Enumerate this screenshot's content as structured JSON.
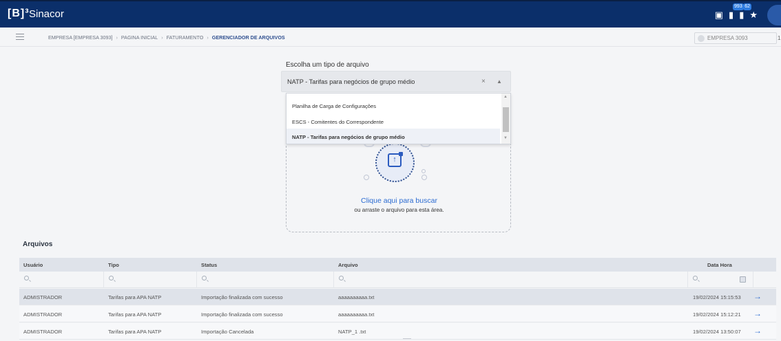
{
  "topbar": {
    "logo": "[B]³",
    "app_name": "Sinacor",
    "icons": [
      {
        "name": "document-icon",
        "glyph": "▣",
        "badge": ""
      },
      {
        "name": "notifications-icon",
        "glyph": "▮",
        "badge": "993"
      },
      {
        "name": "messages-icon",
        "glyph": "▮",
        "badge": "62"
      },
      {
        "name": "favorites-icon",
        "glyph": "★",
        "badge": ""
      }
    ],
    "colors": {
      "bar": "#0b2f6a",
      "badge": "#2f7de1"
    }
  },
  "breadcrumb": {
    "items": [
      "EMPRESA [EMPRESA 3093]",
      "PAGINA INICIAL",
      "FATURAMENTO"
    ],
    "current": "GERENCIADOR DE ARQUIVOS",
    "separator": "›"
  },
  "company_selector": {
    "placeholder": "EMPRESA 3093",
    "edge_text": "1"
  },
  "file_type": {
    "label": "Escolha um tipo de arquivo",
    "selected": "NATP - Tarifas para negócios de grupo médio",
    "clear": "×",
    "caret": "▲",
    "options": [
      {
        "label": "Planilha de Carga de Configurações",
        "selected": false
      },
      {
        "label": "ESCS - Comitentes do Correspondente",
        "selected": false
      },
      {
        "label": "NATP - Tarifas para negócios de grupo médio",
        "selected": true
      }
    ]
  },
  "dropzone": {
    "link": "Clique aqui para buscar",
    "sub": "ou arraste o arquivo para esta área."
  },
  "files": {
    "title": "Arquivos",
    "columns": [
      "Usuário",
      "Tipo",
      "Status",
      "Arquivo",
      "Data Hora"
    ],
    "rows": [
      {
        "user": "ADMISTRADOR",
        "type": "Tarifas para APA NATP",
        "status": "Importação finalizada com sucesso",
        "file": "aaaaaaaaaa.txt",
        "datetime": "19/02/2024 15:15:53"
      },
      {
        "user": "ADMISTRADOR",
        "type": "Tarifas para APA NATP",
        "status": "Importação finalizada com sucesso",
        "file": "aaaaaaaaaa.txt",
        "datetime": "19/02/2024 15:12:21"
      },
      {
        "user": "ADMISTRADOR",
        "type": "Tarifas para APA NATP",
        "status": "Importação Cancelada",
        "file": "NATP_1 .txt",
        "datetime": "19/02/2024 13:50:07"
      }
    ],
    "row_action": "→",
    "colors": {
      "link": "#2b6bd1",
      "header": "#dfe3ea"
    }
  }
}
